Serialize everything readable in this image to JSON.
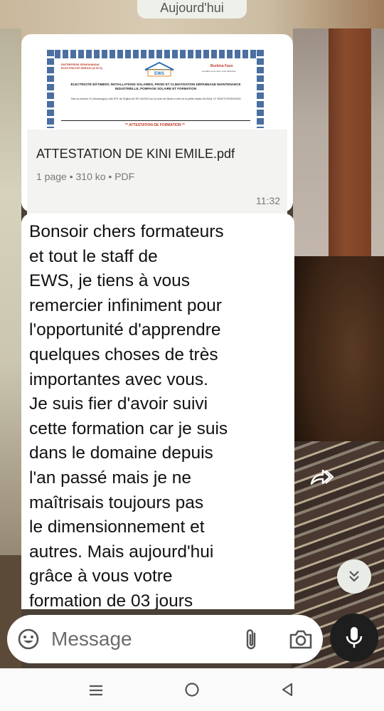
{
  "date_chip": "Aujourd'hui",
  "document_message": {
    "preview": {
      "header_left": "ENTREPRISE SENDIAMANA ÉLECTRICITÉ SERGIO (E W S)",
      "header_right": "Burkina Faso",
      "header_right_sub": "La patrie ou la mort, nous vaincrons",
      "logo_text": "EWS",
      "line1": "ÉLECTRICITÉ BÂTIMENT, INSTALLATIONS SOLAIRES, FROID ET CLIMATISATION DÉPANNAGE MAINTENANCE INDUSTRIELLE, POMPAGE SOLAIRE ET FORMATION",
      "line2": "Sise au secteur 01 (Boudougou) côté EST de l'Eglise AD EE ZAGHO sur la route de Bindé à côté de la petite station BLISAN. N° 0000/747/EWS/2025",
      "title": "** ATTESTATION DE FORMATION **"
    },
    "filename": "ATTESTATION DE KINI EMILE.pdf",
    "meta": "1 page • 310 ko • PDF",
    "time": "11:32"
  },
  "text_message": {
    "body": "Bonsoir chers formateurs\net tout le staff de\nEWS, je tiens à vous\nremercier infiniment pour\nl'opportunité d'apprendre\nquelques choses de très\nimportantes avec vous.\nJe suis fier d'avoir suivi\ncette formation car je suis\ndans le domaine depuis\nl'an passé mais je ne\nmaîtrisais toujours pas\nle dimensionnement et\nautres. Mais aujourd'hui\ngrâce à vous votre\nformation de 03 jours"
  },
  "composer": {
    "placeholder": "Message"
  },
  "icons": {
    "forward": "forward-icon",
    "scroll_down": "double-chevron-down-icon",
    "emoji": "emoji-icon",
    "attach": "paperclip-icon",
    "camera": "camera-icon",
    "mic": "microphone-icon",
    "recents": "recents-icon",
    "home": "home-icon",
    "back": "back-icon"
  },
  "colors": {
    "bubble": "#ffffff",
    "mic_button": "#1e1e1e",
    "date_chip": "#eef0ea"
  }
}
